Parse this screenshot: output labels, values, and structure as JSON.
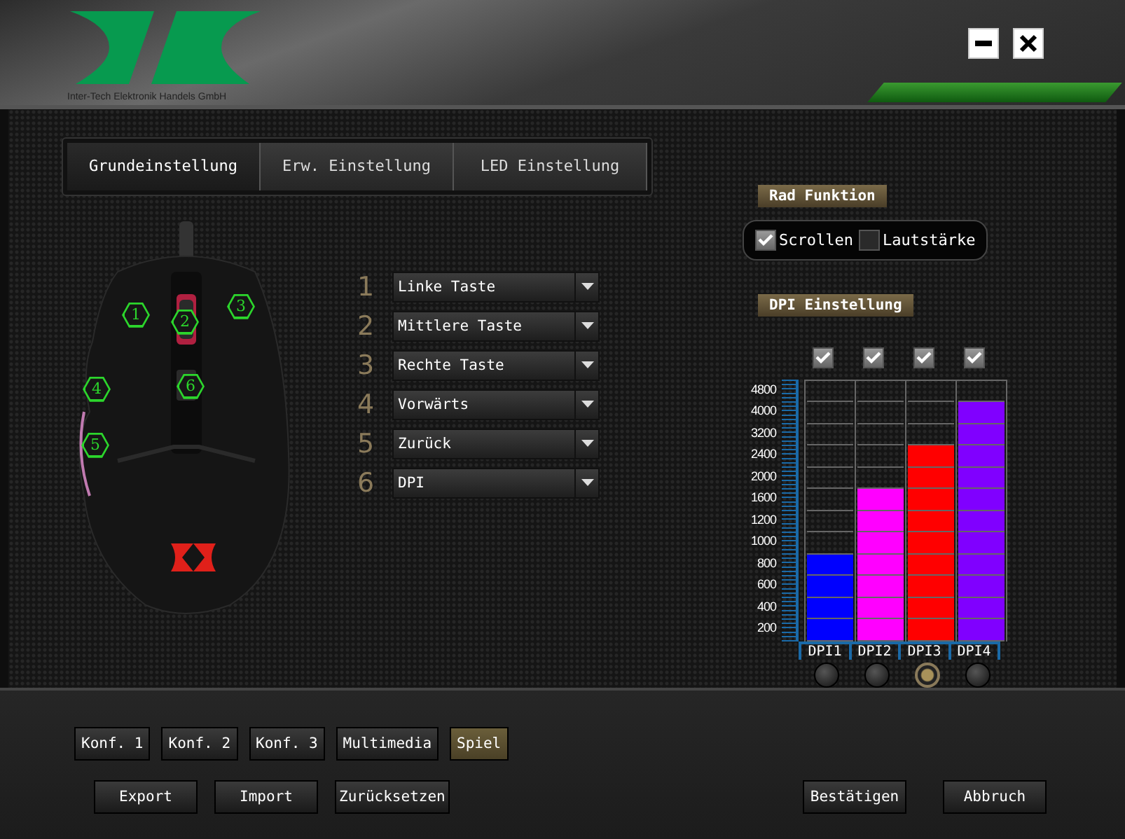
{
  "window": {
    "company": "Inter-Tech Elektronik Handels GmbH"
  },
  "tabs": [
    {
      "label": "Grundeinstellung",
      "selected": true
    },
    {
      "label": "Erw. Einstellung",
      "selected": false
    },
    {
      "label": "LED Einstellung",
      "selected": false
    }
  ],
  "buttons": [
    {
      "number": "1",
      "marker": "1",
      "function": "Linke Taste"
    },
    {
      "number": "2",
      "marker": "2",
      "function": "Mittlere Taste"
    },
    {
      "number": "3",
      "marker": "3",
      "function": "Rechte Taste"
    },
    {
      "number": "4",
      "marker": "4",
      "function": "Vorwärts"
    },
    {
      "number": "5",
      "marker": "5",
      "function": "Zurück"
    },
    {
      "number": "6",
      "marker": "6",
      "function": "DPI"
    }
  ],
  "wheel": {
    "title": "Rad Funktion",
    "options": [
      {
        "label": "Scrollen",
        "checked": true
      },
      {
        "label": "Lautstärke",
        "checked": false
      }
    ]
  },
  "dpi": {
    "title": "DPI Einstellung",
    "scale": [
      "4800",
      "4000",
      "3200",
      "2400",
      "2000",
      "1600",
      "1200",
      "1000",
      "800",
      "600",
      "400",
      "200"
    ],
    "stages": [
      {
        "label": "DPI1",
        "enabled": true,
        "level": 0.333,
        "color": "#0000ff",
        "selected": false
      },
      {
        "label": "DPI2",
        "enabled": true,
        "level": 0.583,
        "color": "#ff00ff",
        "selected": false
      },
      {
        "label": "DPI3",
        "enabled": true,
        "level": 0.75,
        "color": "#ff0000",
        "selected": true
      },
      {
        "label": "DPI4",
        "enabled": true,
        "level": 0.917,
        "color": "#8000ff",
        "selected": false
      }
    ]
  },
  "profiles": [
    {
      "label": "Konf. 1",
      "selected": false
    },
    {
      "label": "Konf. 2",
      "selected": false
    },
    {
      "label": "Konf. 3",
      "selected": false
    },
    {
      "label": "Multimedia",
      "selected": false
    },
    {
      "label": "Spiel",
      "selected": true
    }
  ],
  "actions": [
    "Export",
    "Import",
    "Zurücksetzen"
  ],
  "dialog_buttons": [
    "Bestätigen",
    "Abbruch"
  ]
}
